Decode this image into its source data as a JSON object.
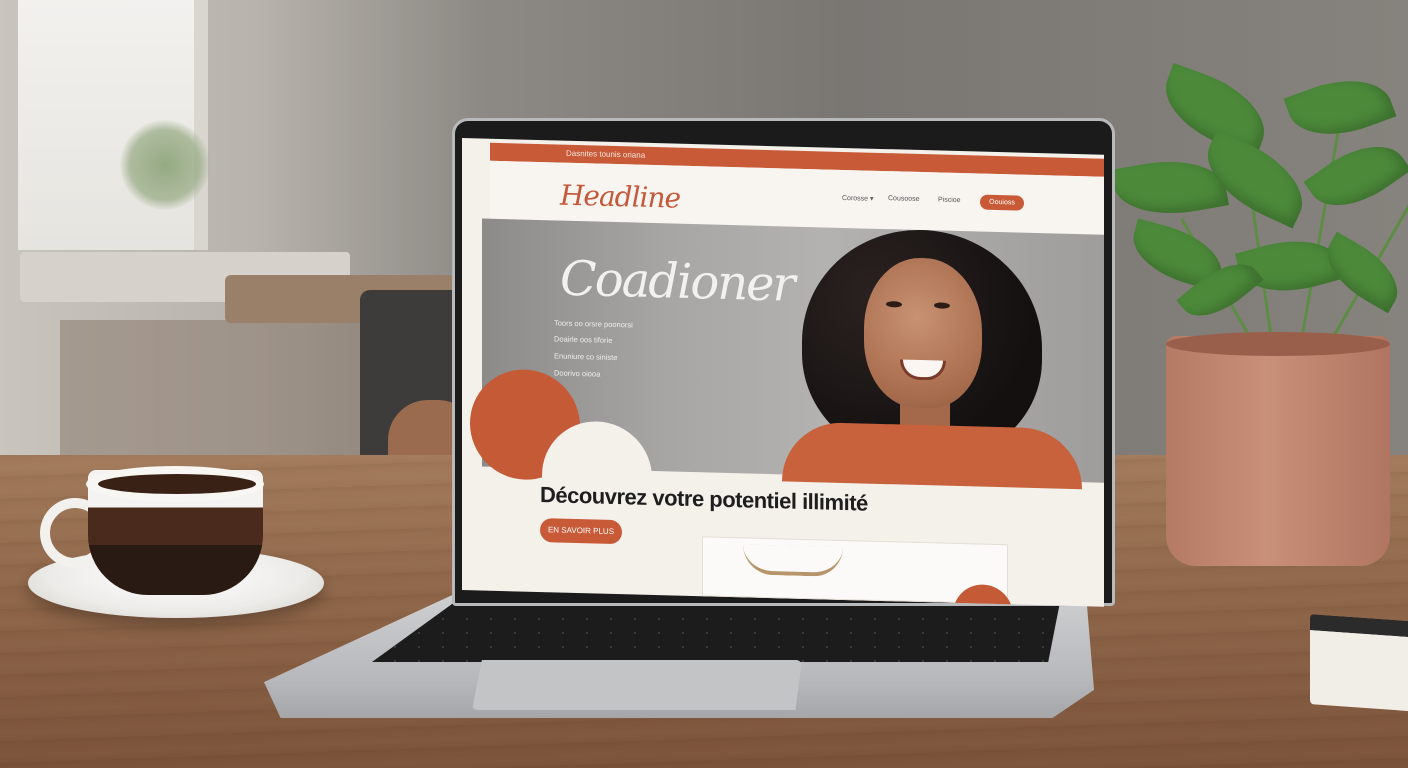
{
  "website": {
    "topbar_text": "Dasnites tounis oriana",
    "logo": "Headline",
    "nav": {
      "items": [
        "Corosse ▾",
        "Cousoose",
        "Piscioe"
      ],
      "cta": "Oouioss"
    },
    "hero": {
      "title": "Coadioner",
      "links": [
        "Toors oo orsre poonorsi",
        "Doairle oos tiforie",
        "Enuniure co siniste",
        "Doorivo oiooa"
      ]
    },
    "section": {
      "heading": "Découvrez votre potentiel illimité",
      "button": "EN SAVOIR PLUS"
    }
  },
  "colors": {
    "accent": "#c95a38",
    "background": "#f4f0ea",
    "hero_gray": "#a7a6a4",
    "text_dark": "#1e1e1e"
  }
}
